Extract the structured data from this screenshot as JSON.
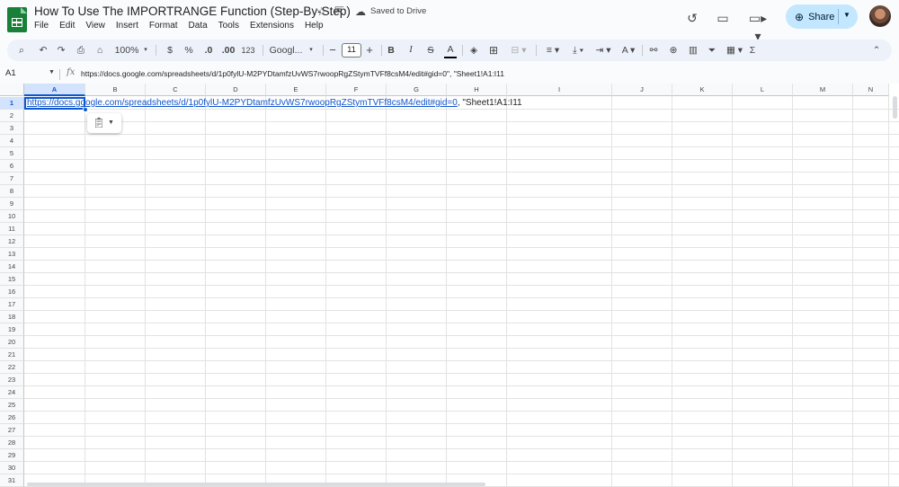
{
  "doc": {
    "title": "How To Use The IMPORTRANGE Function (Step-By-Step)",
    "status": "Saved to Drive"
  },
  "menu": [
    "File",
    "Edit",
    "View",
    "Insert",
    "Format",
    "Data",
    "Tools",
    "Extensions",
    "Help"
  ],
  "header": {
    "share_label": "Share"
  },
  "toolbar": {
    "zoom": "100%",
    "currency": "$",
    "percent": "%",
    "decrease_decimal": ".0",
    "increase_decimal": ".00",
    "number_format": "123",
    "font": "Googl...",
    "font_size": "11",
    "minus": "−",
    "plus": "+",
    "bold": "B",
    "italic": "I",
    "strike": "S",
    "text_color": "A",
    "sigma": "Σ"
  },
  "formula_bar": {
    "cell_ref": "A1",
    "fx": "fx",
    "content": "https://docs.google.com/spreadsheets/d/1p0fylU-M2PYDtamfzUvWS7rwoopRgZStymTVFf8csM4/edit#gid=0\", \"Sheet1!A1:I11"
  },
  "grid": {
    "columns": [
      "A",
      "B",
      "C",
      "D",
      "E",
      "F",
      "G",
      "H",
      "I",
      "J",
      "K",
      "L",
      "M",
      "N"
    ],
    "rows": [
      "1",
      "2",
      "3",
      "4",
      "5",
      "6",
      "7",
      "8",
      "9",
      "10",
      "11",
      "12",
      "13",
      "14",
      "15",
      "16",
      "17",
      "18",
      "19",
      "20",
      "21",
      "22",
      "23",
      "24",
      "25",
      "26",
      "27",
      "28",
      "29",
      "30",
      "31"
    ],
    "selected_cell": "A1",
    "a1_link": "https://docs.google.com/spreadsheets/d/1p0fylU-M2PYDtamfzUvWS7rwoopRgZStymTVFf8csM4/edit#gid=0",
    "a1_rest": ", \"Sheet1!A1:I11"
  },
  "colors": {
    "accent": "#0b57d0",
    "share_bg": "#c2e7ff",
    "sheets_green": "#188038",
    "toolbar_bg": "#edf2fa"
  }
}
